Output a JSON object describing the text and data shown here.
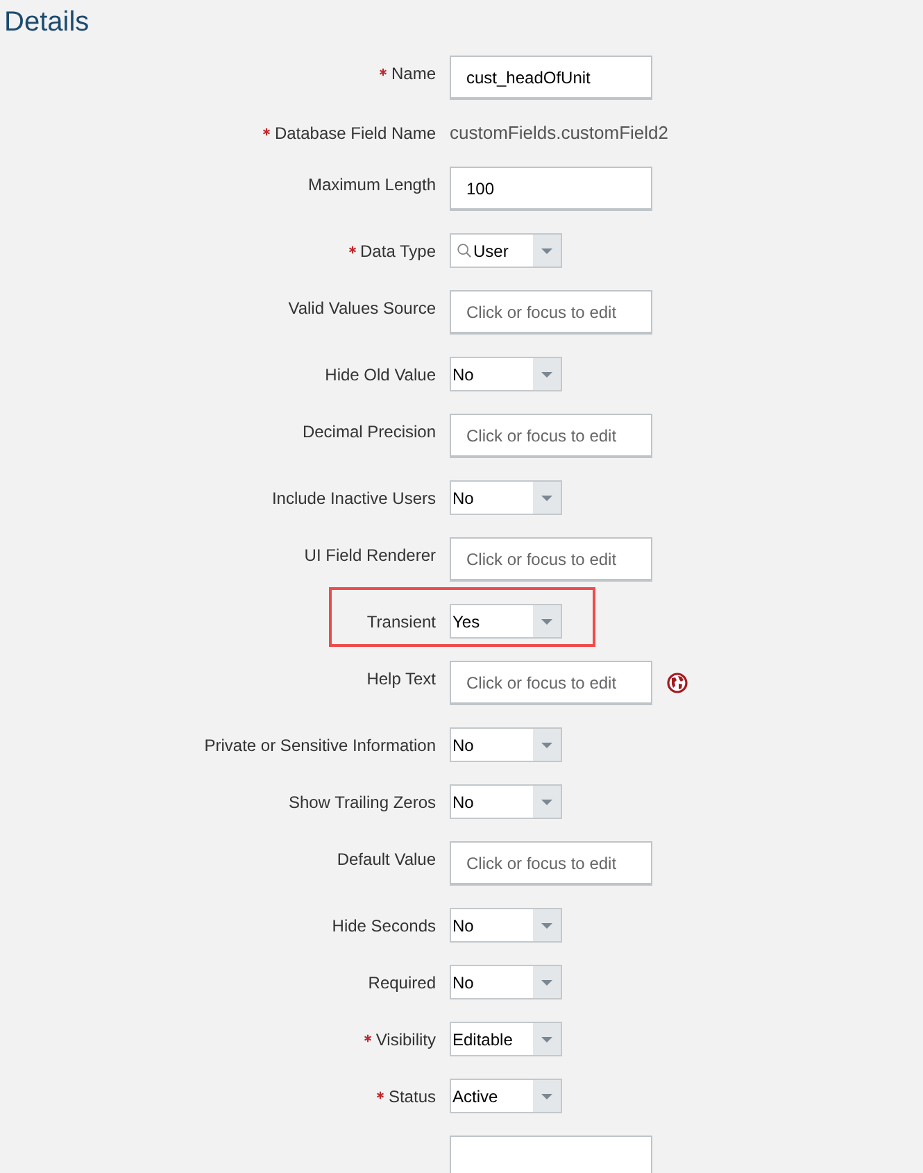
{
  "title": "Details",
  "fields": [
    {
      "kind": "text",
      "label": "Name",
      "required": true,
      "value": "cust_headOfUnit"
    },
    {
      "kind": "static",
      "label": "Database Field Name",
      "required": true,
      "value": "customFields.customField2"
    },
    {
      "kind": "text",
      "label": "Maximum Length",
      "required": false,
      "value": "100"
    },
    {
      "kind": "select",
      "label": "Data Type",
      "required": true,
      "value": "User",
      "search_icon": true
    },
    {
      "kind": "text",
      "label": "Valid Values Source",
      "required": false,
      "placeholder": "Click or focus to edit"
    },
    {
      "kind": "select",
      "label": "Hide Old Value",
      "required": false,
      "value": "No"
    },
    {
      "kind": "text",
      "label": "Decimal Precision",
      "required": false,
      "placeholder": "Click or focus to edit"
    },
    {
      "kind": "select",
      "label": "Include Inactive Users",
      "required": false,
      "value": "No"
    },
    {
      "kind": "text",
      "label": "UI Field Renderer",
      "required": false,
      "placeholder": "Click or focus to edit"
    },
    {
      "kind": "select",
      "label": "Transient",
      "required": false,
      "value": "Yes",
      "highlighted": true
    },
    {
      "kind": "text",
      "label": "Help Text",
      "required": false,
      "placeholder": "Click or focus to edit",
      "translation_icon": true
    },
    {
      "kind": "select",
      "label": "Private or Sensitive Information",
      "required": false,
      "value": "No"
    },
    {
      "kind": "select",
      "label": "Show Trailing Zeros",
      "required": false,
      "value": "No"
    },
    {
      "kind": "text",
      "label": "Default Value",
      "required": false,
      "placeholder": "Click or focus to edit"
    },
    {
      "kind": "select",
      "label": "Hide Seconds",
      "required": false,
      "value": "No"
    },
    {
      "kind": "select",
      "label": "Required",
      "required": false,
      "value": "No"
    },
    {
      "kind": "select",
      "label": "Visibility",
      "required": true,
      "value": "Editable"
    },
    {
      "kind": "select",
      "label": "Status",
      "required": true,
      "value": "Active"
    },
    {
      "kind": "text",
      "required": false
    }
  ]
}
